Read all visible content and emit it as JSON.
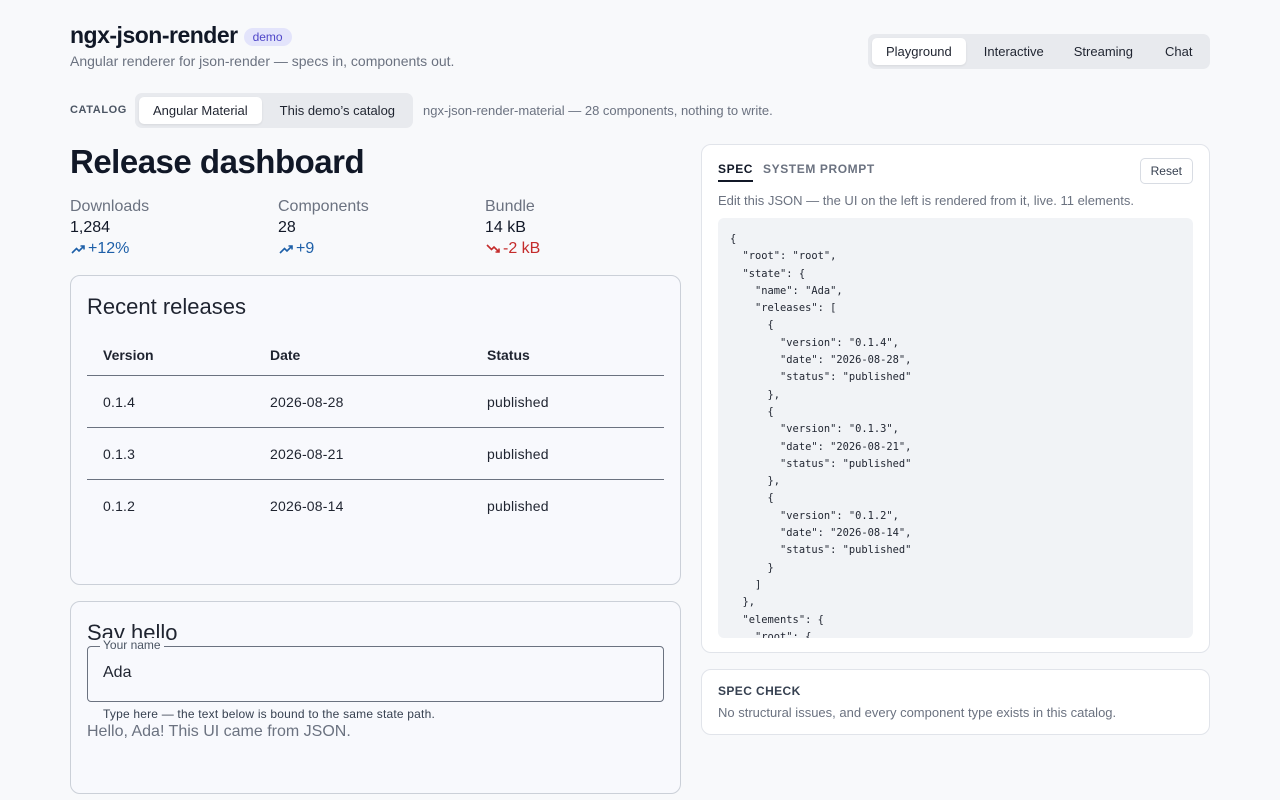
{
  "header": {
    "title": "ngx-json-render",
    "badge": "demo",
    "subtitle": "Angular renderer for json-render — specs in, components out.",
    "nav": [
      {
        "label": "Playground",
        "active": true
      },
      {
        "label": "Interactive",
        "active": false
      },
      {
        "label": "Streaming",
        "active": false
      },
      {
        "label": "Chat",
        "active": false
      }
    ]
  },
  "catalog": {
    "label": "CATALOG",
    "options": [
      "Angular Material",
      "This demo’s catalog"
    ],
    "selected": "Angular Material",
    "note": "ngx-json-render-material — 28 components, nothing to write."
  },
  "dashboard": {
    "title": "Release dashboard",
    "stats": [
      {
        "label": "Downloads",
        "value": "1,284",
        "delta": "+12%",
        "trend": "up"
      },
      {
        "label": "Components",
        "value": "28",
        "delta": "+9",
        "trend": "up"
      },
      {
        "label": "Bundle",
        "value": "14 kB",
        "delta": "-2 kB",
        "trend": "down"
      }
    ],
    "releases": {
      "title": "Recent releases",
      "columns": [
        "Version",
        "Date",
        "Status"
      ],
      "rows": [
        [
          "0.1.4",
          "2026-08-28",
          "published"
        ],
        [
          "0.1.3",
          "2026-08-21",
          "published"
        ],
        [
          "0.1.2",
          "2026-08-14",
          "published"
        ]
      ]
    },
    "hello": {
      "title": "Say hello",
      "field_label": "Your name",
      "field_value": "Ada",
      "hint": "Type here — the text below is bound to the same state path.",
      "greeting": "Hello, Ada! This UI came from JSON."
    }
  },
  "spec_panel": {
    "tabs": [
      {
        "label": "SPEC",
        "active": true
      },
      {
        "label": "SYSTEM PROMPT",
        "active": false
      }
    ],
    "reset_label": "Reset",
    "description": "Edit this JSON — the UI on the left is rendered from it, live. 11 elements.",
    "editor_text": "{\n  \"root\": \"root\",\n  \"state\": {\n    \"name\": \"Ada\",\n    \"releases\": [\n      {\n        \"version\": \"0.1.4\",\n        \"date\": \"2026-08-28\",\n        \"status\": \"published\"\n      },\n      {\n        \"version\": \"0.1.3\",\n        \"date\": \"2026-08-21\",\n        \"status\": \"published\"\n      },\n      {\n        \"version\": \"0.1.2\",\n        \"date\": \"2026-08-14\",\n        \"status\": \"published\"\n      }\n    ]\n  },\n  \"elements\": {\n    \"root\": {"
  },
  "spec_check": {
    "title": "SPEC CHECK",
    "message": "No structural issues, and every component type exists in this catalog."
  }
}
